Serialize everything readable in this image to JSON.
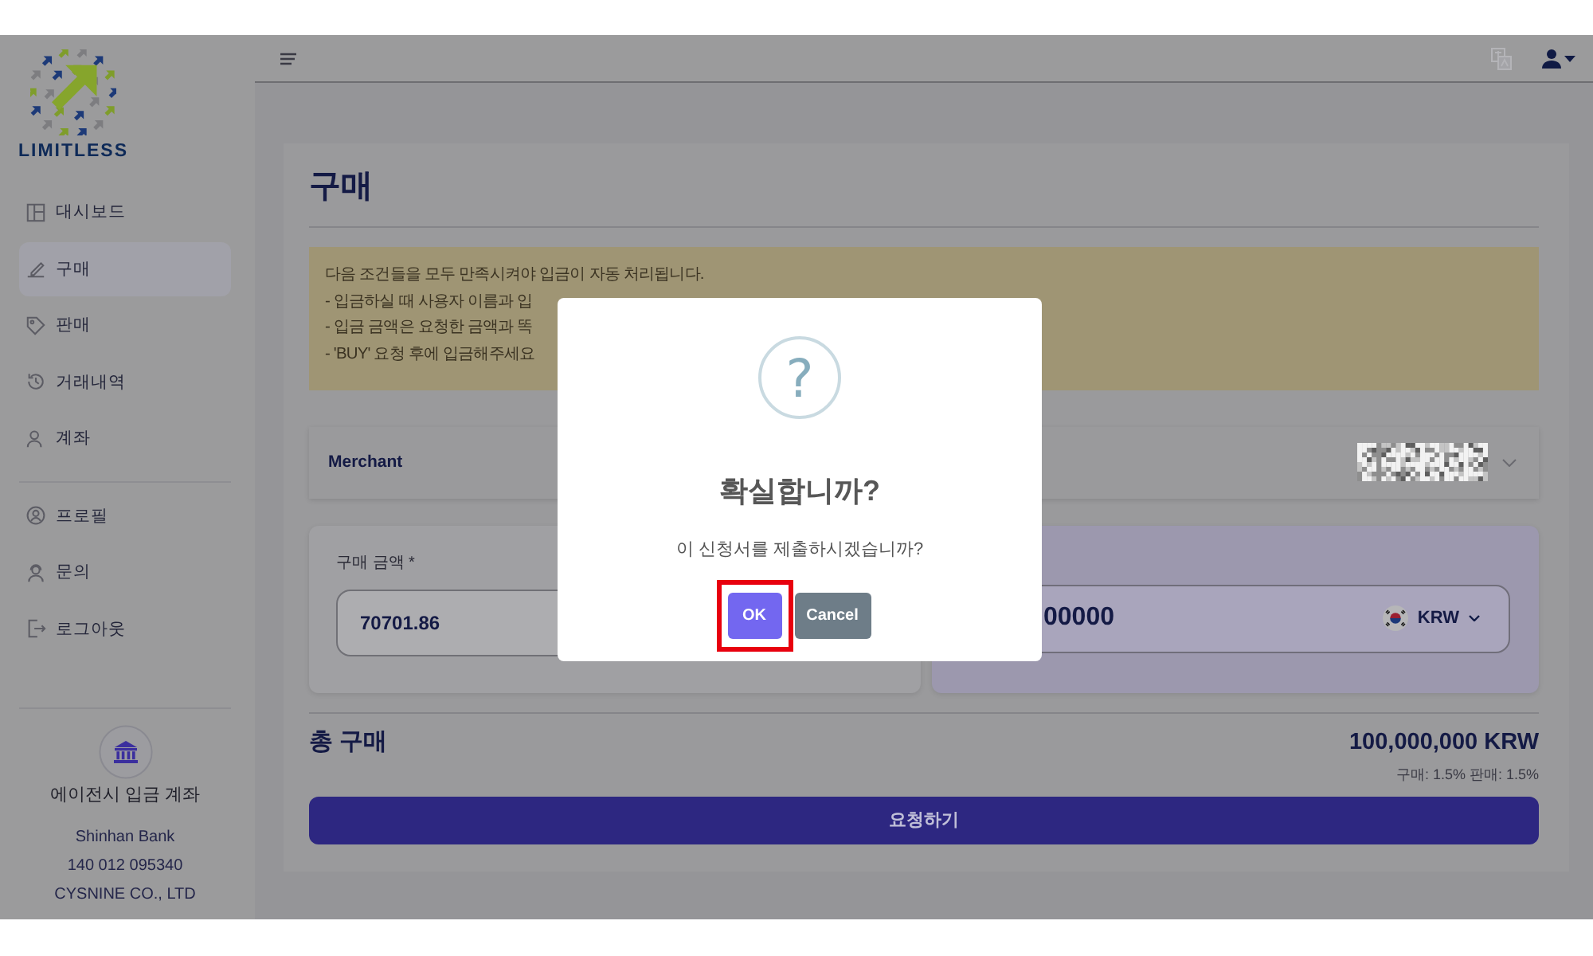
{
  "sidebar": {
    "brand_name": "LIMITLESS",
    "sections": [
      {
        "items": [
          {
            "label": "대시보드",
            "selected": false
          },
          {
            "label": "구매",
            "selected": true
          },
          {
            "label": "판매",
            "selected": false
          },
          {
            "label": "거래내역",
            "selected": false
          },
          {
            "label": "계좌",
            "selected": false
          }
        ]
      },
      {
        "items": [
          {
            "label": "프로필",
            "selected": false
          },
          {
            "label": "문의",
            "selected": false
          },
          {
            "label": "로그아웃",
            "selected": false
          }
        ]
      }
    ],
    "bank_account": {
      "title": "에이전시 입금 계좌",
      "bank": "Shinhan Bank",
      "account_number": "140 012 095340",
      "holder": "CYSNINE CO., LTD"
    }
  },
  "page": {
    "title": "구매",
    "notice_lines": [
      "다음 조건들을 모두 만족시켜야 입금이 자동 처리됩니다.",
      "- 입금하실 때 사용자 이름과 입",
      "- 입금 금액은 요청한 금액과 똑",
      "- 'BUY' 요청 후에 입금해주세요"
    ],
    "merchant": {
      "label": "Merchant"
    },
    "amount_panel": {
      "label": "구매 금액 *",
      "value": "70701.86"
    },
    "converted_panel": {
      "value": "00000",
      "currency": "KRW"
    },
    "total": {
      "label": "총 구매",
      "value": "100,000,000 KRW",
      "fees": "구매: 1.5% 판매: 1.5%"
    },
    "submit_button": "요청하기"
  },
  "dialog": {
    "icon_glyph": "?",
    "title": "확실합니까?",
    "message": "이 신청서를 제출하시겠습니까?",
    "buttons": [
      {
        "label": "OK",
        "kind": "confirm",
        "highlighted": true
      },
      {
        "label": "Cancel",
        "kind": "cancel",
        "highlighted": false
      }
    ]
  }
}
